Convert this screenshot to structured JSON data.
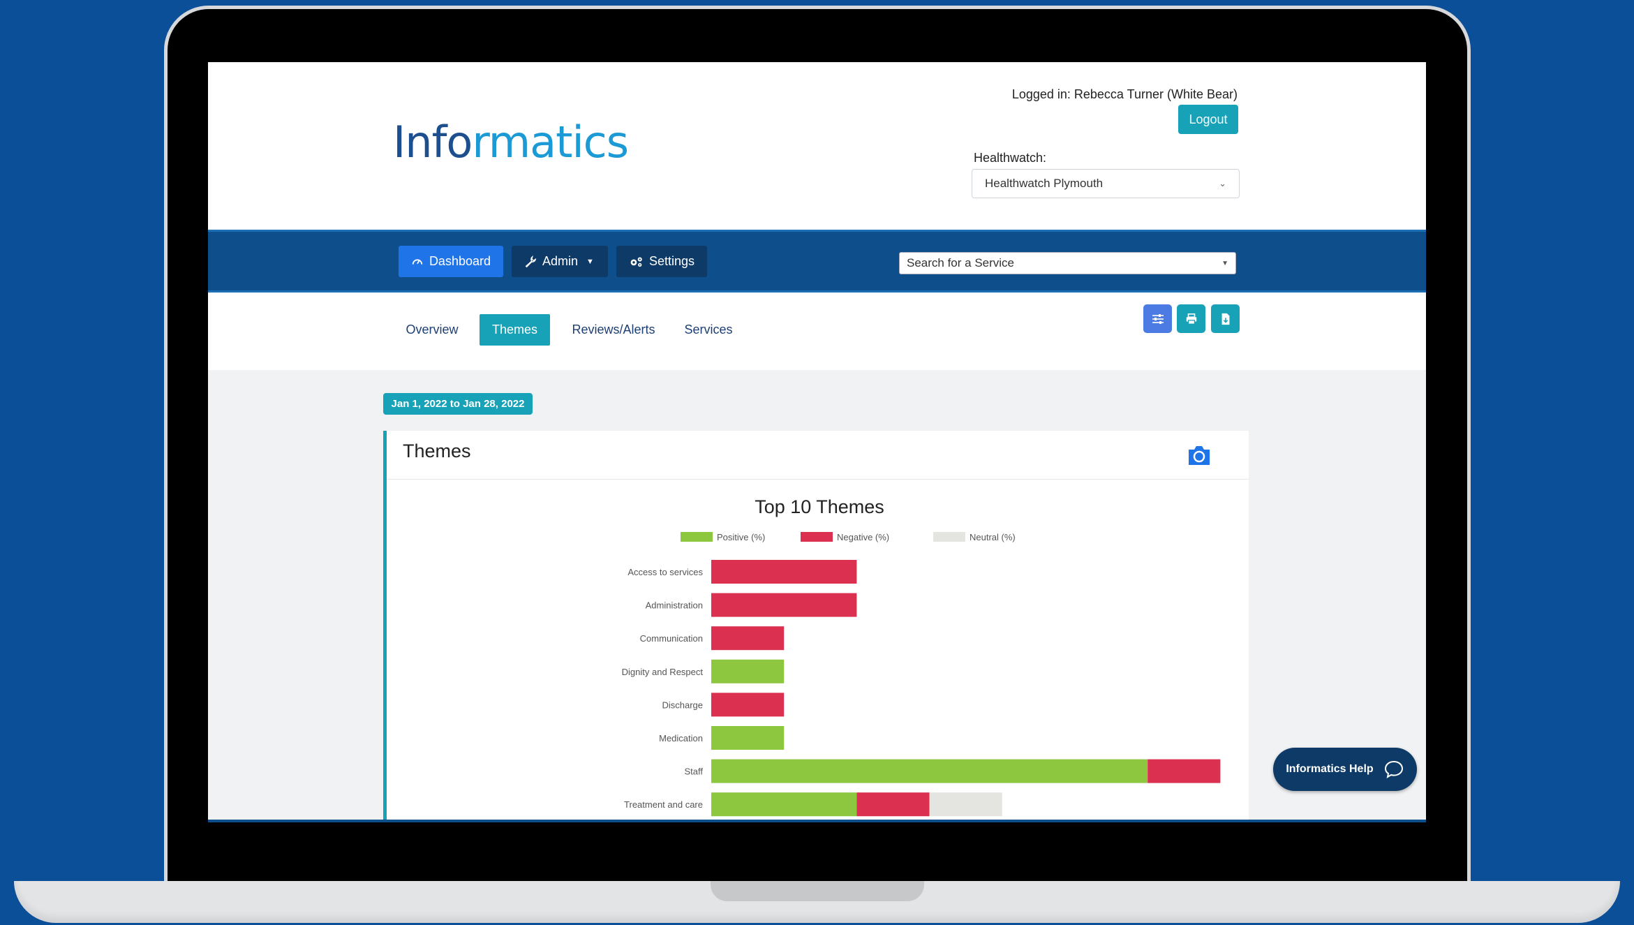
{
  "logo": {
    "part1": "Info",
    "part2": "r",
    "part3": "matics"
  },
  "header": {
    "logged_in": "Logged in: Rebecca Turner (White Bear)",
    "logout_label": "Logout",
    "healthwatch_label": "Healthwatch:",
    "healthwatch_value": "Healthwatch Plymouth"
  },
  "nav": {
    "dashboard": "Dashboard",
    "admin": "Admin",
    "settings": "Settings",
    "search_value": "Search for a Service"
  },
  "tabs": {
    "overview": "Overview",
    "themes": "Themes",
    "reviews": "Reviews/Alerts",
    "services": "Services"
  },
  "date_range": "Jan 1, 2022 to Jan 28, 2022",
  "card": {
    "title": "Themes"
  },
  "help": {
    "label": "Informatics Help"
  },
  "colors": {
    "positive": "#8dc63f",
    "negative": "#dc3051",
    "neutral": "#e4e4e1",
    "accent": "#17a2b8"
  },
  "chart_data": {
    "type": "bar",
    "orientation": "horizontal",
    "stacked": true,
    "title": "Top 10 Themes",
    "categories": [
      "Access to services",
      "Administration",
      "Communication",
      "Dignity and Respect",
      "Discharge",
      "Medication",
      "Staff",
      "Treatment and care"
    ],
    "series": [
      {
        "name": "Positive (%)",
        "values": [
          0,
          0,
          0,
          1,
          0,
          1,
          6,
          2
        ]
      },
      {
        "name": "Negative (%)",
        "values": [
          2,
          2,
          1,
          0,
          1,
          0,
          1,
          1
        ]
      },
      {
        "name": "Neutral (%)",
        "values": [
          0,
          0,
          0,
          0,
          0,
          0,
          0,
          1
        ]
      }
    ],
    "legend_position": "top",
    "xlim": [
      0,
      10
    ],
    "grid": false
  }
}
